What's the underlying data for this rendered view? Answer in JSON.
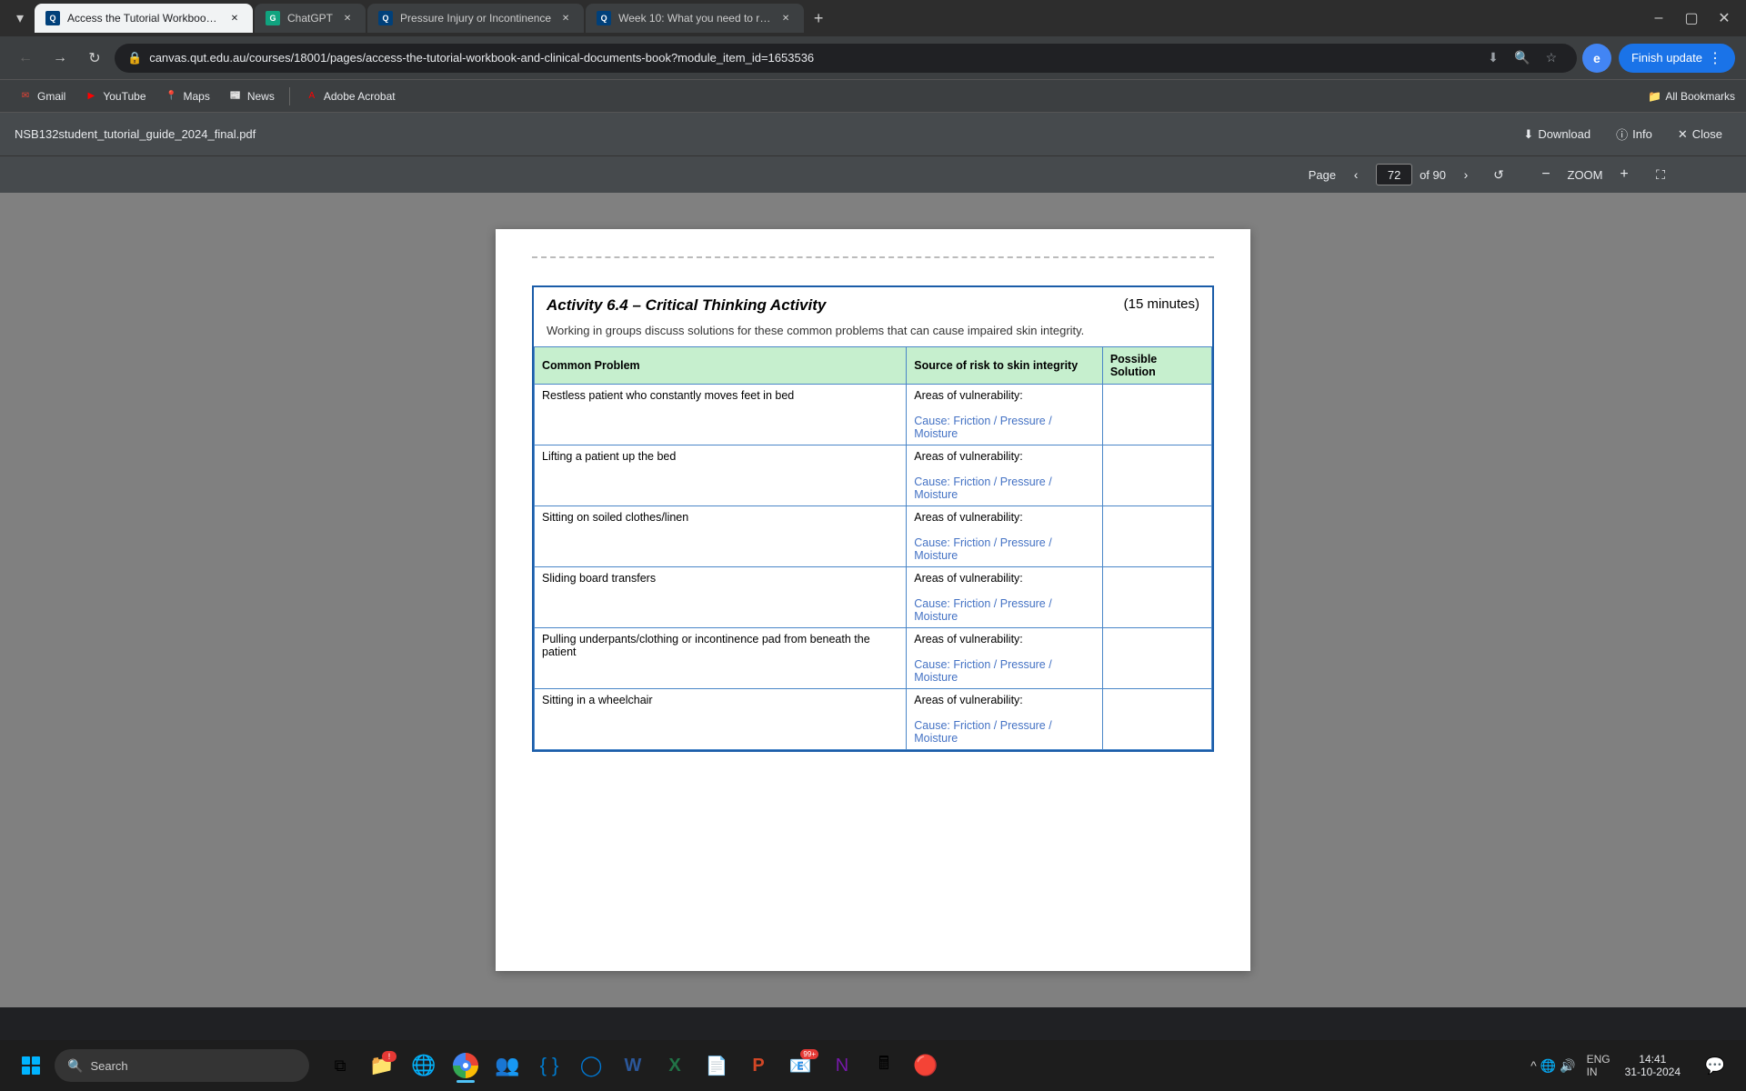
{
  "browser": {
    "tabs": [
      {
        "id": "tab1",
        "favicon": "qut",
        "label": "Access the Tutorial Workbook a",
        "active": true
      },
      {
        "id": "tab2",
        "favicon": "chatgpt",
        "label": "ChatGPT",
        "active": false
      },
      {
        "id": "tab3",
        "favicon": "qut",
        "label": "Pressure Injury or Incontinence",
        "active": false
      },
      {
        "id": "tab4",
        "favicon": "qut",
        "label": "Week 10: What you need to re...",
        "active": false
      }
    ],
    "address": "canvas.qut.edu.au/courses/18001/pages/access-the-tutorial-workbook-and-clinical-documents-book?module_item_id=1653536",
    "finish_update_label": "Finish update"
  },
  "bookmarks": [
    {
      "id": "gmail",
      "label": "Gmail",
      "icon": "gmail"
    },
    {
      "id": "youtube",
      "label": "YouTube",
      "icon": "youtube"
    },
    {
      "id": "maps",
      "label": "Maps",
      "icon": "maps"
    },
    {
      "id": "news",
      "label": "News",
      "icon": "news"
    },
    {
      "id": "acrobat",
      "label": "Adobe Acrobat",
      "icon": "acrobat"
    }
  ],
  "bookmarks_right": "All Bookmarks",
  "pdf": {
    "filename": "NSB132student_tutorial_guide_2024_final.pdf",
    "download_label": "Download",
    "info_label": "Info",
    "close_label": "Close",
    "page_label": "Page",
    "current_page": "72",
    "total_pages": "of 90",
    "zoom_label": "ZOOM",
    "activity": {
      "title": "Activity 6.4 – Critical Thinking Activity",
      "time": "(15 minutes)",
      "description": "Working in groups discuss solutions for these common problems that can cause impaired skin integrity.",
      "table": {
        "headers": [
          "Common Problem",
          "Source of risk to skin integrity",
          "Possible Solution"
        ],
        "rows": [
          {
            "problem": "Restless patient who constantly moves feet in bed",
            "source": "Areas of vulnerability:",
            "cause": "Cause: Friction / Pressure / Moisture",
            "solution": ""
          },
          {
            "problem": "Lifting a patient up the bed",
            "source": "Areas of vulnerability:",
            "cause": "Cause: Friction / Pressure / Moisture",
            "solution": ""
          },
          {
            "problem": "Sitting on soiled clothes/linen",
            "source": "Areas of vulnerability:",
            "cause": "Cause: Friction / Pressure / Moisture",
            "solution": ""
          },
          {
            "problem": "Sliding board transfers",
            "source": "Areas of vulnerability:",
            "cause": "Cause: Friction / Pressure / Moisture",
            "solution": ""
          },
          {
            "problem": "Pulling underpants/clothing or incontinence pad from beneath the patient",
            "source": "Areas of vulnerability:",
            "cause": "Cause: Friction / Pressure / Moisture",
            "solution": ""
          },
          {
            "problem": "Sitting in a wheelchair",
            "source": "Areas of vulnerability:",
            "cause": "Cause: Friction / Pressure / Moisture",
            "solution": ""
          }
        ]
      }
    }
  },
  "taskbar": {
    "search_placeholder": "Search",
    "time": "14:41",
    "date": "31-10-2024",
    "language": "ENG\nIN"
  }
}
